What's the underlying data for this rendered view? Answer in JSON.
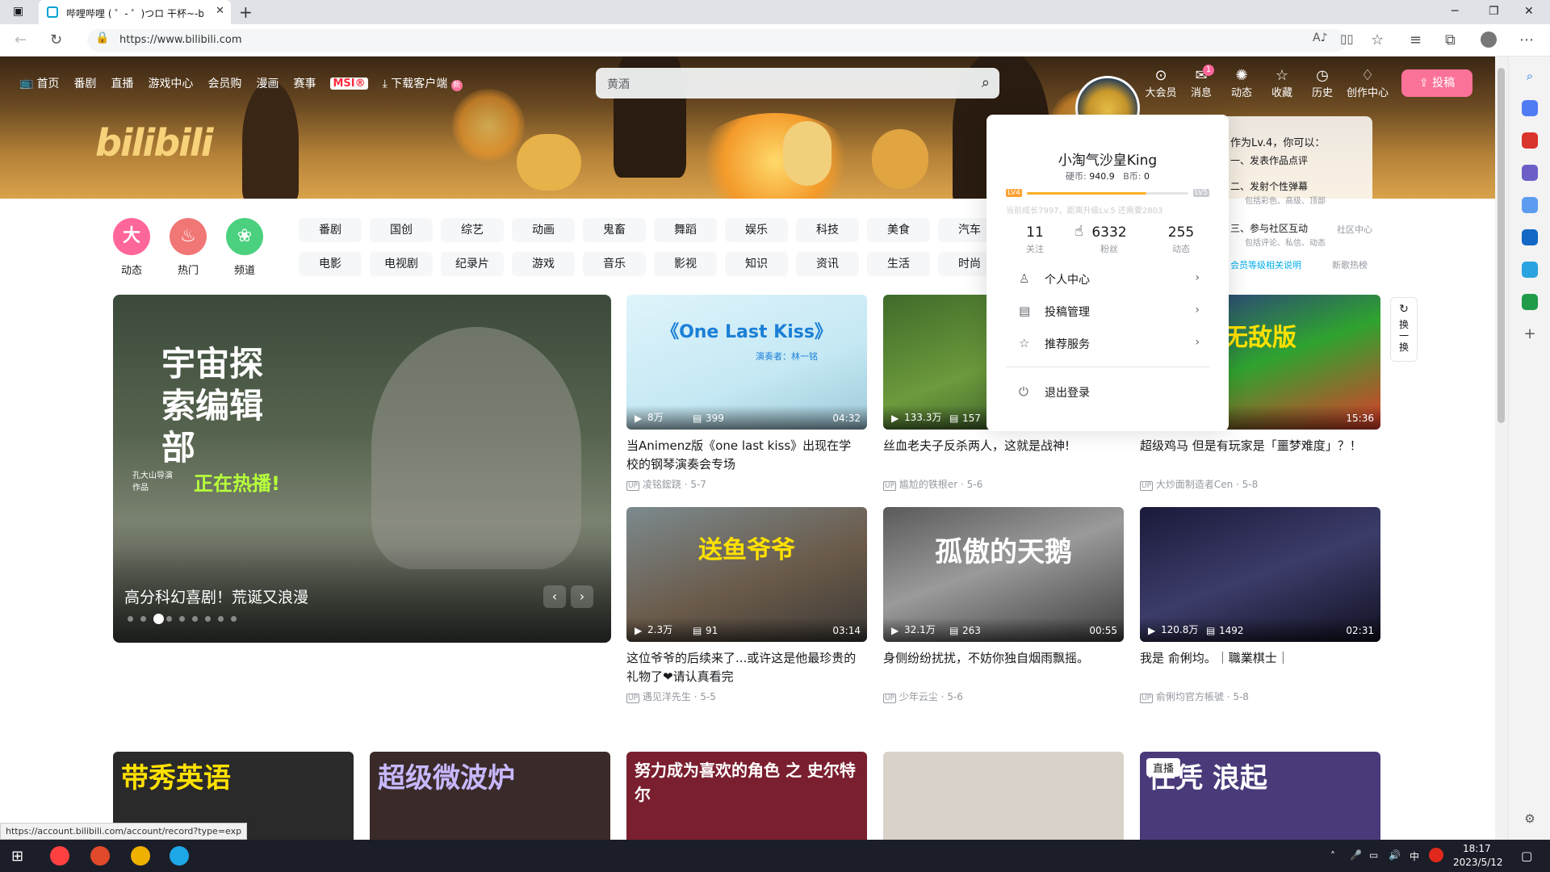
{
  "browser": {
    "tab_title": "哔哩哔哩 ( ゜- ゜)つロ 干杯~-bili",
    "url": "https://www.bilibili.com",
    "status_url": "https://account.bilibili.com/account/record?type=exp",
    "minimize": "─",
    "restore": "❐",
    "close": "✕"
  },
  "nav": {
    "items": [
      "首页",
      "番剧",
      "直播",
      "游戏中心",
      "会员购",
      "漫画",
      "赛事"
    ],
    "msi": "MSI®",
    "download": "下载客户端",
    "download_badge": "新"
  },
  "search": {
    "placeholder": "黄酒"
  },
  "header_icons": [
    {
      "label": "大会员",
      "icon": "vip-icon",
      "glyph": "⊙"
    },
    {
      "label": "消息",
      "icon": "message-icon",
      "glyph": "✉"
    },
    {
      "label": "动态",
      "icon": "dynamic-icon",
      "glyph": "✺"
    },
    {
      "label": "收藏",
      "icon": "star-icon",
      "glyph": "☆"
    },
    {
      "label": "历史",
      "icon": "history-icon",
      "glyph": "◷"
    },
    {
      "label": "创作中心",
      "icon": "bulb-icon",
      "glyph": "♢"
    }
  ],
  "message_badge": "1",
  "upload_label": "投稿",
  "channels": [
    {
      "label": "动态",
      "glyph": "大",
      "color": "#ff6699"
    },
    {
      "label": "热门",
      "glyph": "♨",
      "color": "#f07775"
    },
    {
      "label": "频道",
      "glyph": "❀",
      "color": "#4ad07e"
    }
  ],
  "categories_row1": [
    "番剧",
    "国创",
    "综艺",
    "动画",
    "鬼畜",
    "舞蹈",
    "娱乐",
    "科技",
    "美食",
    "汽车"
  ],
  "categories_row2": [
    "电影",
    "电视剧",
    "纪录片",
    "游戏",
    "音乐",
    "影视",
    "知识",
    "资讯",
    "生活",
    "时尚"
  ],
  "carousel": {
    "title": "高分科幻喜剧！荒诞又浪漫",
    "poster_text": "宇宙探索编辑部",
    "poster_sub": "正在热播!",
    "poster_credit": "孔大山导演作品",
    "prev": "‹",
    "next": "›",
    "dots": 9,
    "active": 2
  },
  "videos": [
    {
      "title": "当Animenz版《one last kiss》出现在学校的钢琴演奏会专场",
      "views": "8万",
      "danmaku": "399",
      "duration": "04:32",
      "author": "凌铭鋐跷",
      "date": "5-7",
      "thumb_text": "《One Last Kiss》",
      "thumb_sub": "演奏者：林一铭"
    },
    {
      "title": "丝血老夫子反杀两人，这就是战神!",
      "views": "133.3万",
      "danmaku": "157",
      "duration": "",
      "author": "尴尬的铁根er",
      "date": "5-6",
      "thumb_text": "",
      "thumb_sub": ""
    },
    {
      "title": "超级鸡马 但是有玩家是「噩梦难度」？！",
      "views": "",
      "danmaku": "",
      "duration": "15:36",
      "author": "大炒面制造者Cen",
      "date": "5-8",
      "thumb_text": "无敌版",
      "thumb_sub": ""
    },
    {
      "title": "这位爷爷的后续来了...或许这是他最珍贵的礼物了❤请认真看完",
      "views": "2.3万",
      "danmaku": "91",
      "duration": "03:14",
      "author": "遇见洋先生",
      "date": "5-5",
      "thumb_text": "送鱼爷爷",
      "thumb_sub": ""
    },
    {
      "title": "身侧纷纷扰扰，不妨你独自烟雨飘摇。",
      "views": "32.1万",
      "danmaku": "263",
      "duration": "00:55",
      "author": "少年云尘",
      "date": "5-6",
      "thumb_text": "孤傲的天鹅",
      "thumb_sub": ""
    },
    {
      "title": "我是 俞俐均。｜職業棋士｜",
      "views": "120.8万",
      "danmaku": "1492",
      "duration": "02:31",
      "author": "俞俐均官方帳號",
      "date": "5-8",
      "thumb_text": "",
      "thumb_sub": ""
    }
  ],
  "bottom_thumbs": [
    "带秀英语",
    "超级微波炉",
    "努力成为喜欢的角色 之 史尔特尔",
    "",
    "任凭 浪起"
  ],
  "live_badge": "直播",
  "refresh_label": "换一换",
  "user": {
    "name": "小淘气沙皇King",
    "coins_label": "硬币:",
    "coins": "940.9",
    "bcoins_label": "B币:",
    "bcoins": "0",
    "level_from": "LV4",
    "level_to": "LV5",
    "growth_text": "当前成长7997，距离升级Lv.5 还需要2803",
    "following": "11",
    "following_label": "关注",
    "fans": "6332",
    "fans_label": "粉丝",
    "dynamic": "255",
    "dynamic_label": "动态",
    "menu": [
      {
        "label": "个人中心",
        "icon": "user-icon",
        "glyph": "♙"
      },
      {
        "label": "投稿管理",
        "icon": "manage-icon",
        "glyph": "▤"
      },
      {
        "label": "推荐服务",
        "icon": "recommend-icon",
        "glyph": "☆"
      }
    ],
    "logout": "退出登录",
    "side_title": "作为Lv.4，你可以：",
    "side_items": [
      "一、发表作品点评",
      "二、发射个性弹幕",
      "包括彩色、高级、顶部",
      "三、参与社区互动",
      "包括评论、私信、动态"
    ],
    "side_link1": "会员等级相关说明",
    "side_link2": "新歌热榜",
    "side_link3": "社区中心"
  },
  "taskbar": {
    "time": "18:17",
    "date": "2023/5/12",
    "ime": "中"
  }
}
